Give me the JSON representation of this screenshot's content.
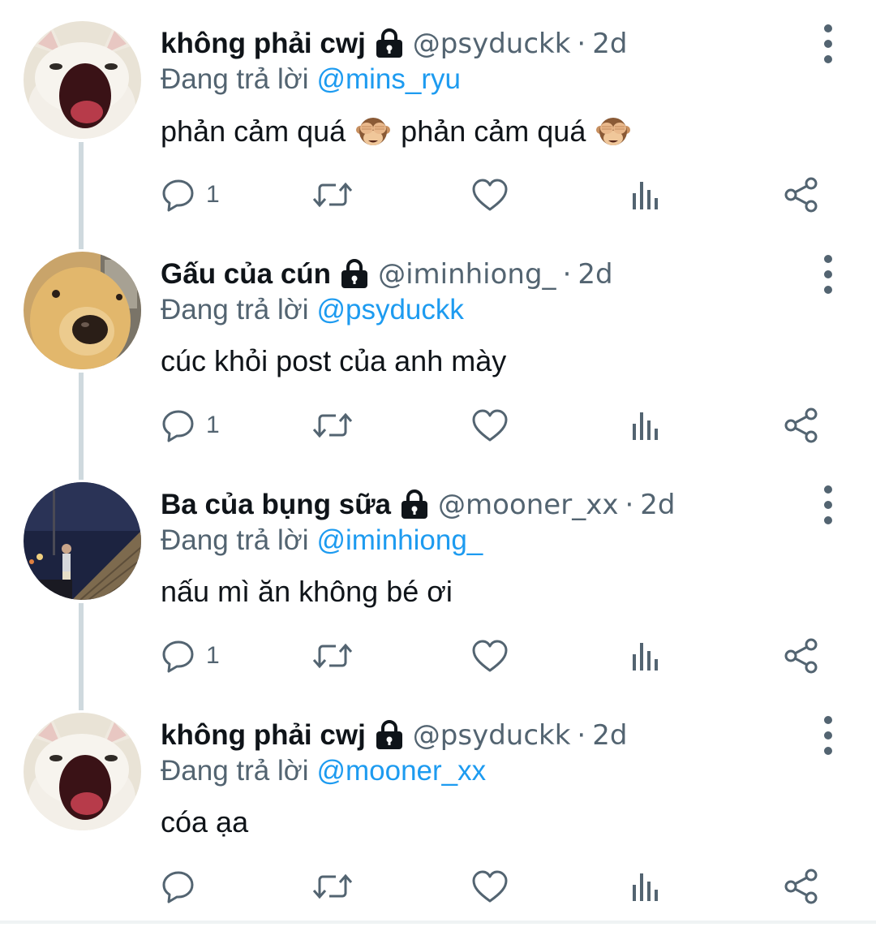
{
  "colors": {
    "link": "#1d9bf0",
    "secondary_text": "#536471",
    "primary_text": "#0f1419",
    "thread_line": "#cfd9de"
  },
  "tweets": [
    {
      "display_name": "không phải cwj",
      "protected_icon": "lock-icon",
      "handle": "@psyduckk",
      "separator": "·",
      "time": "2d",
      "reply_prefix": "Đang trả lời",
      "reply_to": "@mins_ryu",
      "text_part1": "phản cảm quá",
      "text_emoji_1": "see-no-evil-monkey",
      "text_part2": "phản cảm quá",
      "text_emoji_2": "see-no-evil-monkey",
      "reply_count": "1",
      "avatar": "cat-avatar"
    },
    {
      "display_name": "Gấu của cún",
      "protected_icon": "lock-icon",
      "handle": "@iminhiong_",
      "separator": "·",
      "time": "2d",
      "reply_prefix": "Đang trả lời",
      "reply_to": "@psyduckk",
      "text": "cúc khỏi post của anh mày",
      "reply_count": "1",
      "avatar": "dog-avatar"
    },
    {
      "display_name": "Ba của bụng sữa",
      "protected_icon": "lock-icon",
      "handle": "@mooner_xx",
      "separator": "·",
      "time": "2d",
      "reply_prefix": "Đang trả lời",
      "reply_to": "@iminhiong_",
      "text": "nấu mì ăn không bé ơi",
      "reply_count": "1",
      "avatar": "night-street-avatar"
    },
    {
      "display_name": "không phải cwj",
      "protected_icon": "lock-icon",
      "handle": "@psyduckk",
      "separator": "·",
      "time": "2d",
      "reply_prefix": "Đang trả lời",
      "reply_to": "@mooner_xx",
      "text": "cóa ạa",
      "reply_count": "",
      "avatar": "cat-avatar"
    }
  ],
  "actions": [
    "reply-icon",
    "retweet-icon",
    "like-icon",
    "views-icon",
    "share-icon"
  ]
}
